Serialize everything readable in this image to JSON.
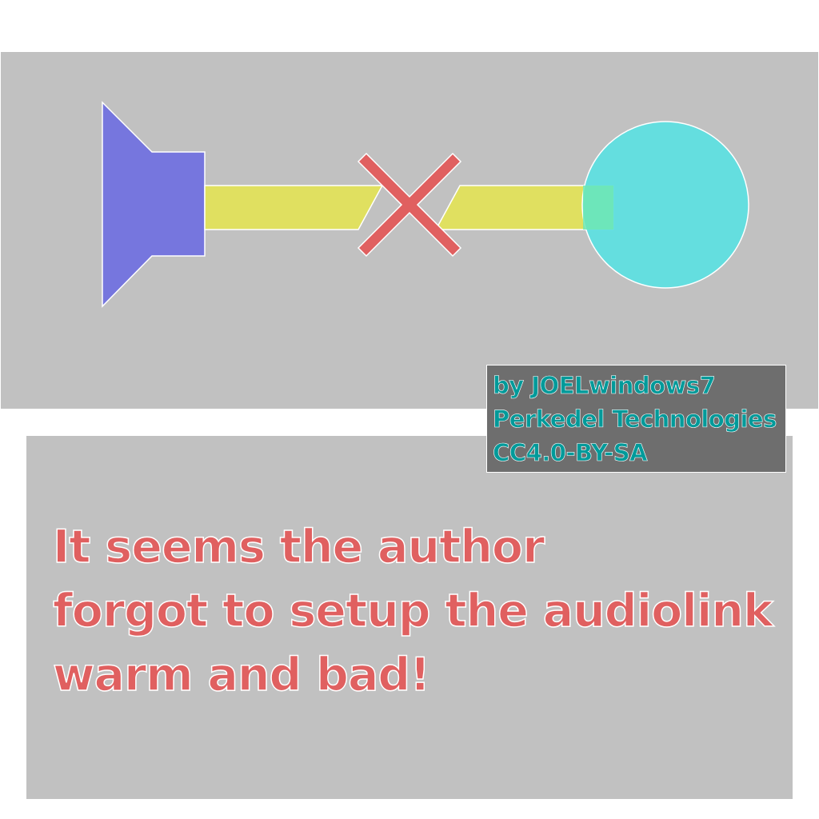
{
  "credits": {
    "author": "by JOELwindows7",
    "company": "Perkedel Technologies",
    "license": "CC4.0-BY-SA"
  },
  "message": {
    "line1": "It seems the author",
    "line2": "forgot to setup the audiolink",
    "line3": "warm and bad!"
  },
  "colors": {
    "panel": "#c1c1c1",
    "speaker": "#7676de",
    "cable": "#e0e060",
    "cross": "#e06060",
    "orb": "#60dfe0",
    "credit_text": "#009a9a",
    "message_text": "#e06060"
  },
  "icons": {
    "speaker": "speaker-icon",
    "cable": "broken-cable",
    "cross": "cross-icon",
    "orb": "circle-orb"
  }
}
